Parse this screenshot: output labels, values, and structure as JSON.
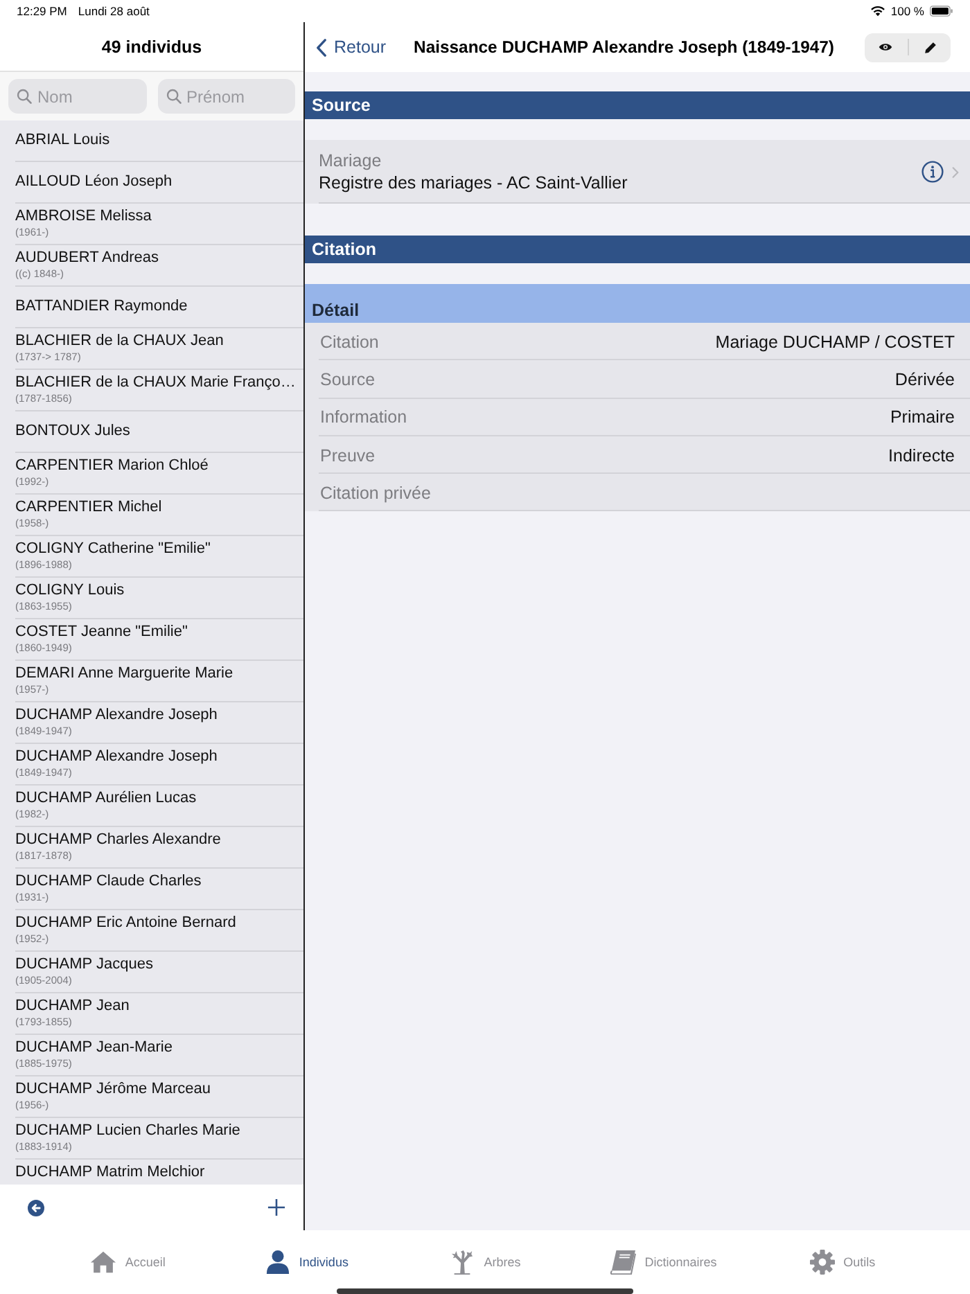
{
  "status_bar": {
    "time": "12:29 PM",
    "date": "Lundi 28 août",
    "battery": "100 %"
  },
  "list_pane": {
    "title": "49 individus",
    "search_fields": [
      {
        "placeholder": "Nom"
      },
      {
        "placeholder": "Prénom"
      }
    ],
    "people": [
      {
        "name": "ABRIAL Louis"
      },
      {
        "name": "AILLOUD Léon Joseph"
      },
      {
        "name": "AMBROISE Melissa",
        "dates": "(1961-)"
      },
      {
        "name": "AUDUBERT Andreas",
        "dates": "((c) 1848-)"
      },
      {
        "name": "BATTANDIER Raymonde"
      },
      {
        "name": "BLACHIER de la CHAUX Jean",
        "dates": "(1737-> 1787)"
      },
      {
        "name": "BLACHIER de la CHAUX Marie Franço…",
        "dates": "(1787-1856)"
      },
      {
        "name": "BONTOUX Jules"
      },
      {
        "name": "CARPENTIER Marion Chloé",
        "dates": "(1992-)"
      },
      {
        "name": "CARPENTIER Michel",
        "dates": "(1958-)"
      },
      {
        "name": "COLIGNY Catherine \"Emilie\"",
        "dates": "(1896-1988)"
      },
      {
        "name": "COLIGNY Louis",
        "dates": "(1863-1955)"
      },
      {
        "name": "COSTET Jeanne \"Emilie\"",
        "dates": "(1860-1949)"
      },
      {
        "name": "DEMARI Anne Marguerite Marie",
        "dates": "(1957-)"
      },
      {
        "name": "DUCHAMP Alexandre Joseph",
        "dates": "(1849-1947)"
      },
      {
        "name": "DUCHAMP Alexandre Joseph",
        "dates": "(1849-1947)"
      },
      {
        "name": "DUCHAMP Aurélien Lucas",
        "dates": "(1982-)"
      },
      {
        "name": "DUCHAMP Charles Alexandre",
        "dates": "(1817-1878)"
      },
      {
        "name": "DUCHAMP Claude Charles",
        "dates": "(1931-)"
      },
      {
        "name": "DUCHAMP Eric Antoine Bernard",
        "dates": "(1952-)"
      },
      {
        "name": "DUCHAMP Jacques",
        "dates": "(1905-2004)"
      },
      {
        "name": "DUCHAMP Jean",
        "dates": "(1793-1855)"
      },
      {
        "name": "DUCHAMP Jean-Marie",
        "dates": "(1885-1975)"
      },
      {
        "name": "DUCHAMP Jérôme Marceau",
        "dates": "(1956-)"
      },
      {
        "name": "DUCHAMP Lucien Charles Marie",
        "dates": "(1883-1914)"
      },
      {
        "name": "DUCHAMP Matrim Melchior"
      }
    ]
  },
  "detail": {
    "back": "Retour",
    "title": "Naissance DUCHAMP Alexandre Joseph (1849-1947)",
    "source": {
      "title": "Source",
      "row": {
        "label": "Mariage",
        "value": "Registre des mariages - AC Saint-Vallier"
      }
    },
    "citation": {
      "title": "Citation",
      "detail": {
        "title": "Détail",
        "fields": [
          {
            "label": "Citation",
            "value": "Mariage DUCHAMP / COSTET"
          },
          {
            "label": "Source",
            "value": "Dérivée"
          },
          {
            "label": "Information",
            "value": "Primaire"
          },
          {
            "label": "Preuve",
            "value": "Indirecte"
          },
          {
            "label": "Citation privée"
          }
        ]
      }
    }
  },
  "tab_bar": [
    {
      "label": "Accueil",
      "selected": false
    },
    {
      "label": "Individus",
      "selected": true
    },
    {
      "label": "Arbres",
      "selected": false
    },
    {
      "label": "Dictionnaires",
      "selected": false
    },
    {
      "label": "Outils",
      "selected": false
    }
  ]
}
